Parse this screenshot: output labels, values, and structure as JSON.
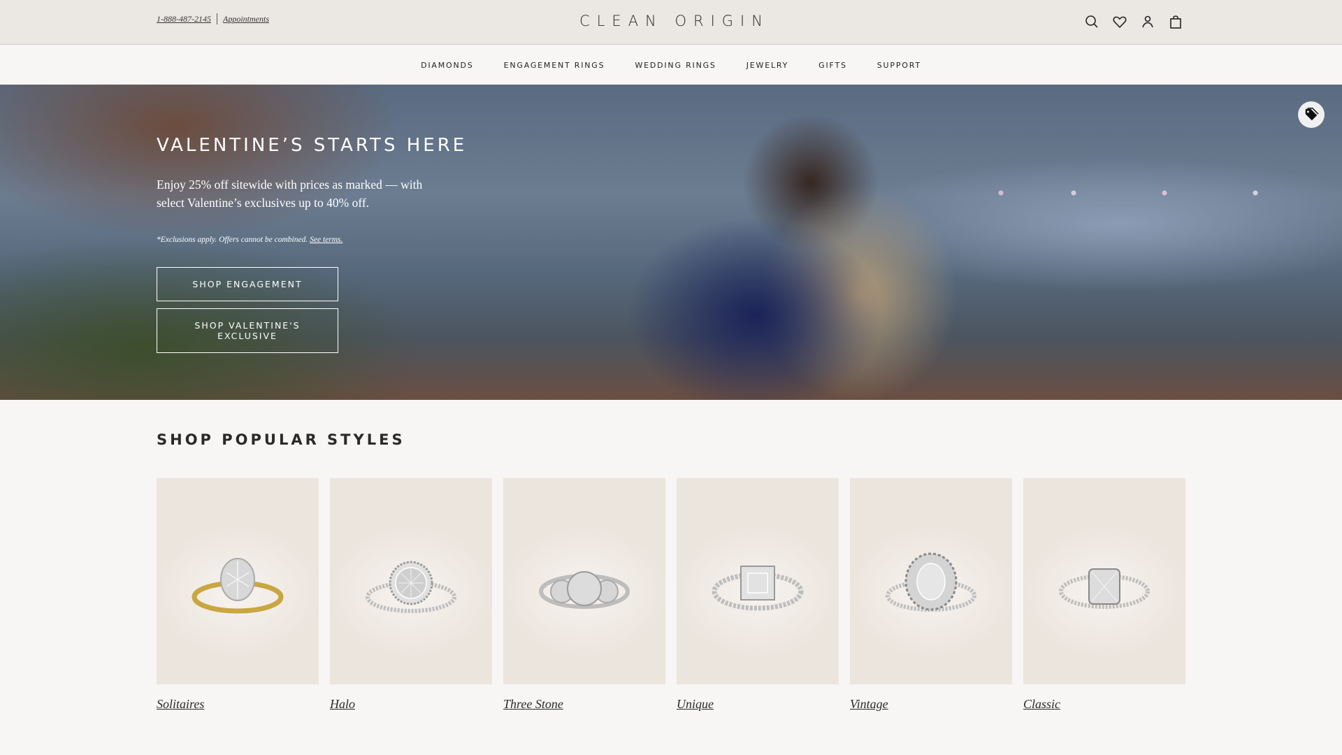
{
  "topbar": {
    "phone": "1-888-487-2145",
    "appointments": "Appointments",
    "logo": "CLEAN ORIGIN",
    "icons": [
      "search-icon",
      "heart-icon",
      "account-icon",
      "bag-icon"
    ]
  },
  "nav": {
    "items": [
      "DIAMONDS",
      "ENGAGEMENT RINGS",
      "WEDDING RINGS",
      "JEWELRY",
      "GIFTS",
      "SUPPORT"
    ]
  },
  "hero": {
    "title": "VALENTINE’S STARTS HERE",
    "body": "Enjoy 25% off sitewide with prices as marked — with select Valentine’s exclusives up to 40% off.",
    "note": "*Exclusions apply. Offers cannot be combined.",
    "note_link": "See terms.",
    "button_engagement": "SHOP ENGAGEMENT",
    "button_valentines": "SHOP VALENTINE'S EXCLUSIVE",
    "badge_icon": "tag-icon"
  },
  "popular": {
    "title": "SHOP POPULAR STYLES",
    "items": [
      {
        "label": "Solitaires",
        "metal": "#c9a640"
      },
      {
        "label": "Halo",
        "metal": "#b8b8b8"
      },
      {
        "label": "Three Stone",
        "metal": "#b8b8b8"
      },
      {
        "label": "Unique",
        "metal": "#b8b8b8"
      },
      {
        "label": "Vintage",
        "metal": "#b8b8b8"
      },
      {
        "label": "Classic",
        "metal": "#b8b8b8"
      }
    ]
  }
}
